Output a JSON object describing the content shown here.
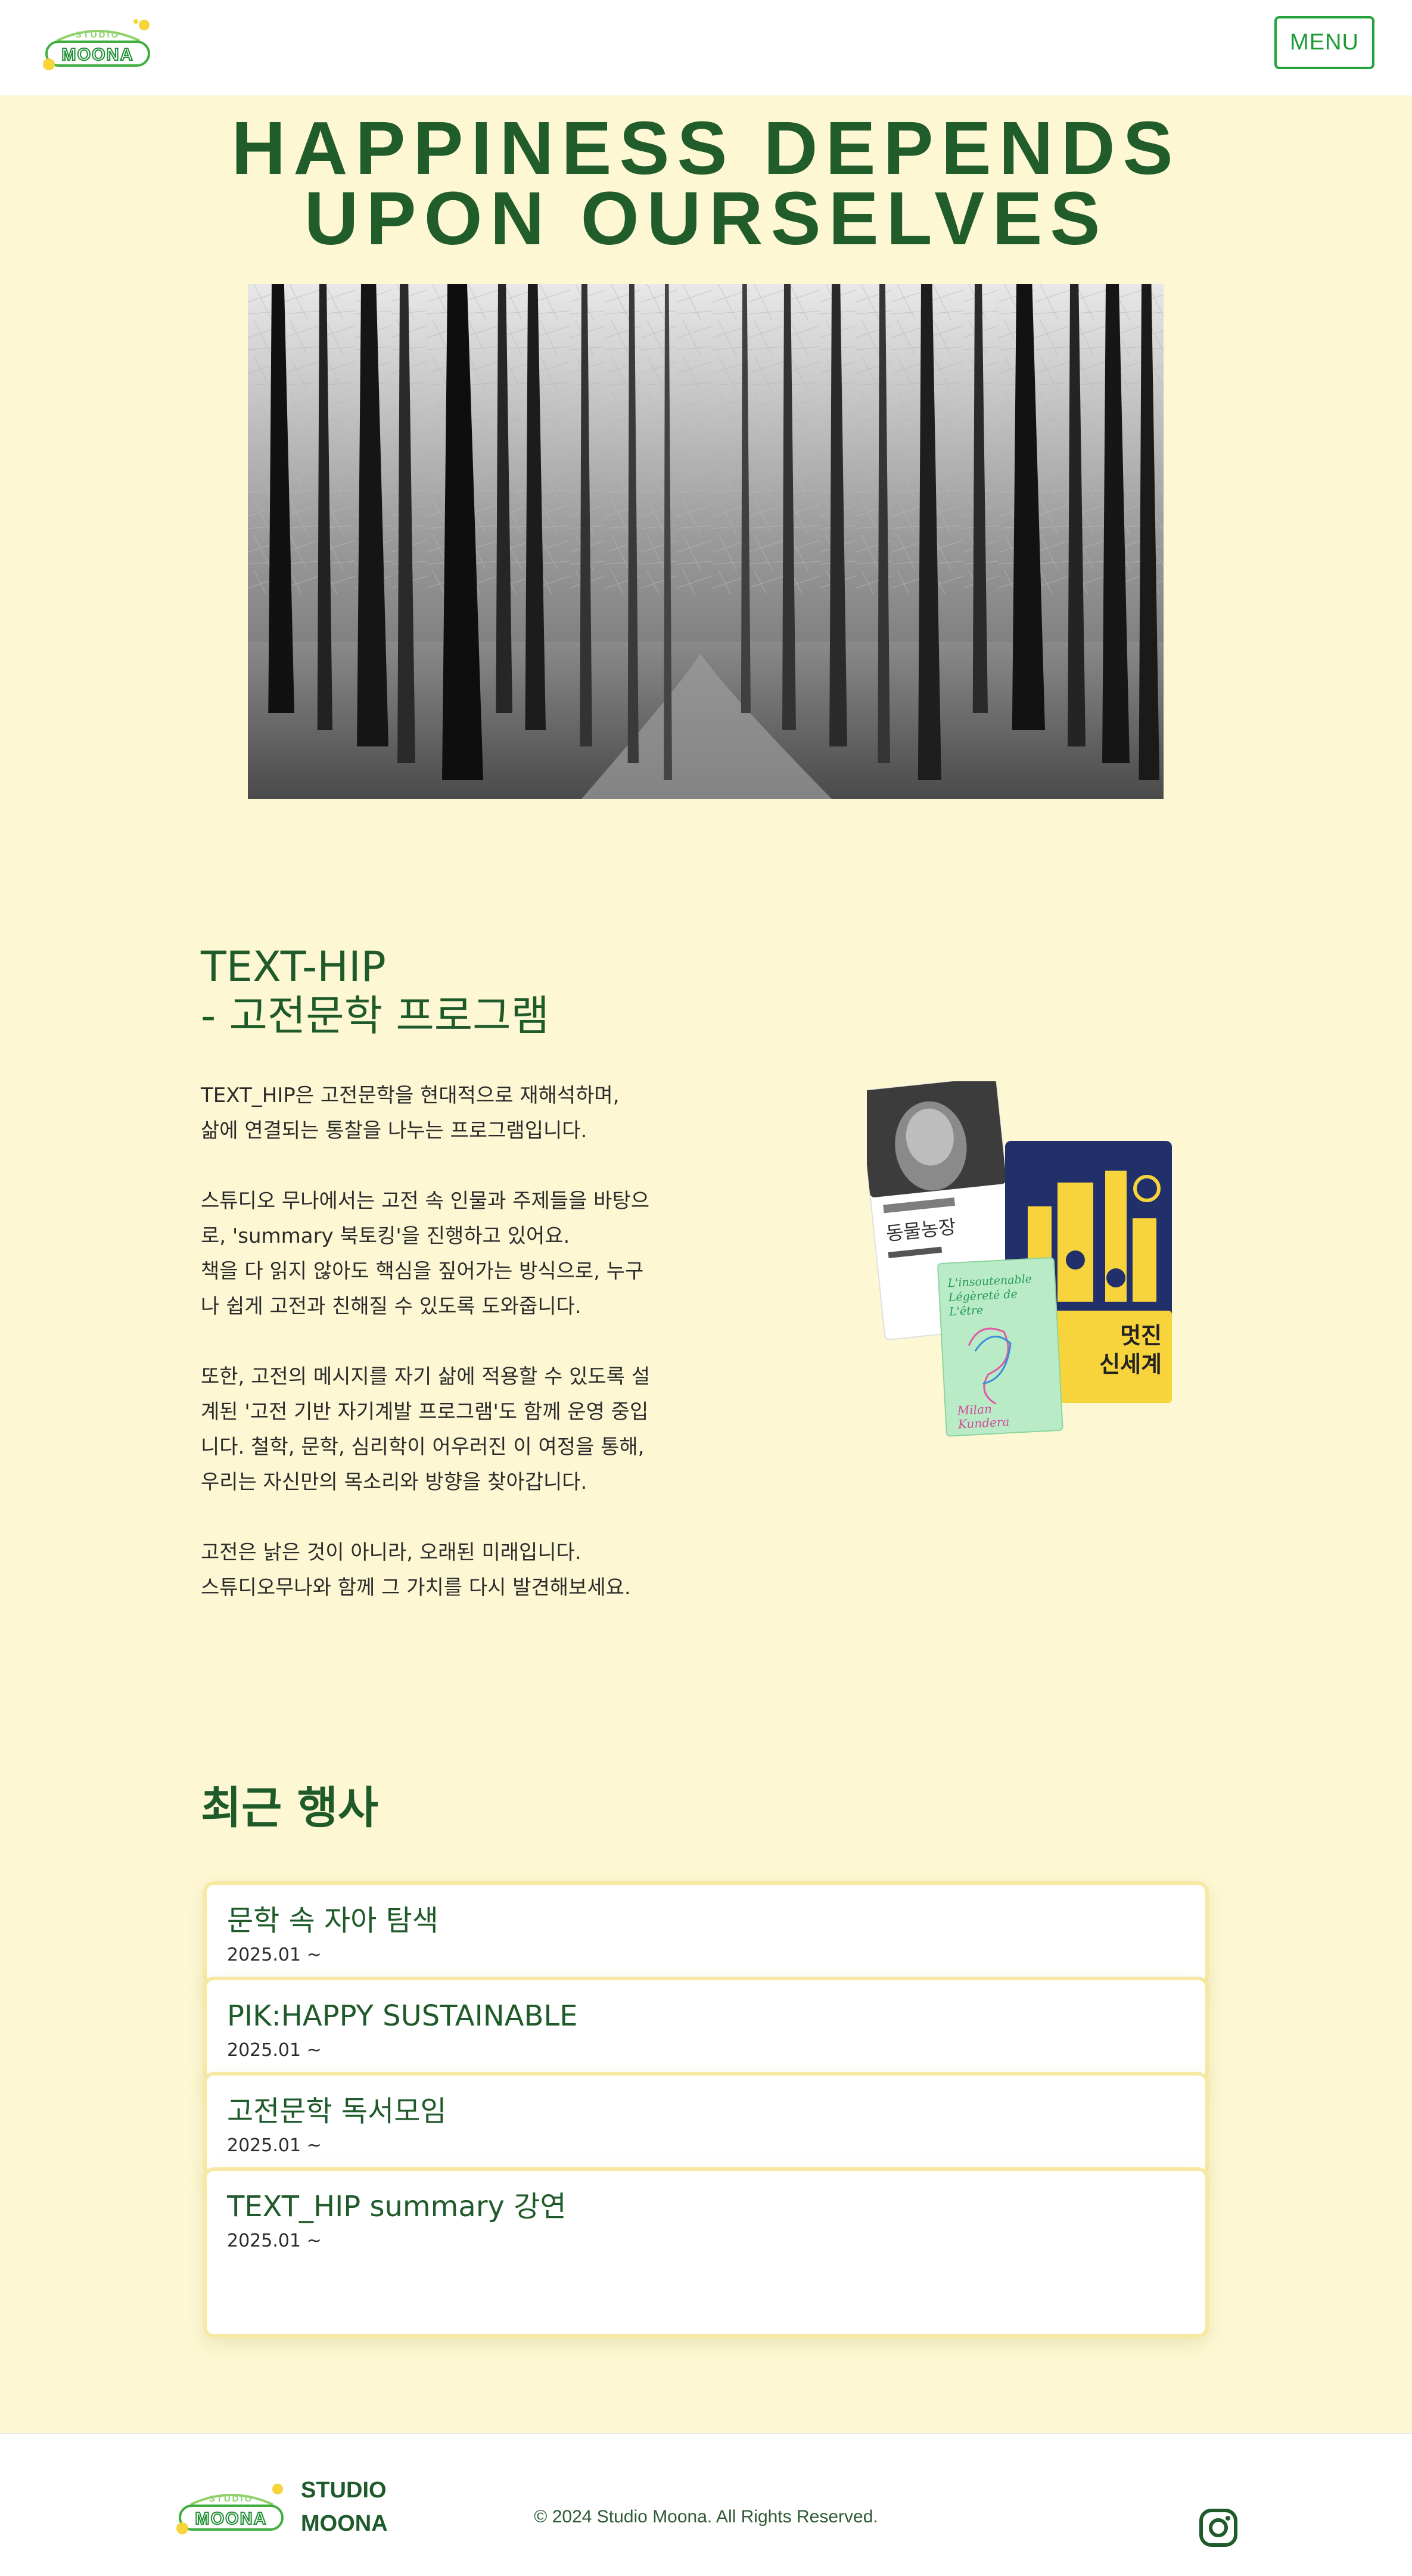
{
  "header": {
    "logo_text_top": "STUDIO",
    "logo_text_main": "MOONA",
    "menu_label": "MENU"
  },
  "hero": {
    "title_line1": "HAPPINESS DEPENDS",
    "title_line2": "UPON OURSELVES",
    "image_subject": "black-and-white forest path"
  },
  "program": {
    "title_line1": "TEXT-HIP",
    "title_line2": "- 고전문학 프로그램",
    "paragraphs": [
      "TEXT_HIP은 고전문학을 현대적으로 재해석하며,\n삶에 연결되는 통찰을 나누는 프로그램입니다.",
      "스튜디오 무나에서는 고전 속 인물과 주제들을 바탕으\n로, 'summary 북토킹'을 진행하고 있어요.\n책을 다 읽지 않아도 핵심을 짚어가는 방식으로, 누구\n나 쉽게 고전과 친해질 수 있도록 도와줍니다.",
      "또한, 고전의 메시지를 자기 삶에 적용할 수 있도록 설\n계된 '고전 기반 자기계발 프로그램'도 함께 운영 중입\n니다. 철학, 문학, 심리학이 어우러진 이 여정을 통해,\n우리는 자신만의 목소리와 방향을 찾아갑니다.",
      "고전은 낡은 것이 아니라, 오래된 미래입니다.\n스튜디오무나와 함께 그 가치를 다시 발견해보세요."
    ],
    "books": {
      "book1_title": "동물농장",
      "book2_title_line1": "멋진",
      "book2_title_line2": "신세계",
      "book3_script_lines": [
        "L'insoutenable",
        "Légèreté de",
        "L'être"
      ],
      "book3_author_lines": [
        "Milan",
        "Kundera"
      ]
    }
  },
  "events": {
    "title": "최근 행사",
    "items": [
      {
        "name": "문학 속 자아 탐색",
        "date": "2025.01 ~"
      },
      {
        "name": "PIK:HAPPY SUSTAINABLE",
        "date": "2025.01 ~"
      },
      {
        "name": "고전문학 독서모임",
        "date": "2025.01 ~"
      },
      {
        "name": "TEXT_HIP summary 강연",
        "date": "2025.01 ~"
      }
    ]
  },
  "footer": {
    "brand_line1": "STUDIO",
    "brand_line2": "MOONA",
    "copyright": "© 2024 Studio Moona. All Rights Reserved.",
    "social_icon": "instagram-icon"
  },
  "colors": {
    "background": "#fdf8d3",
    "primary_green": "#215c2b",
    "accent_green": "#21a33a",
    "card_border": "#f7e9a2"
  }
}
